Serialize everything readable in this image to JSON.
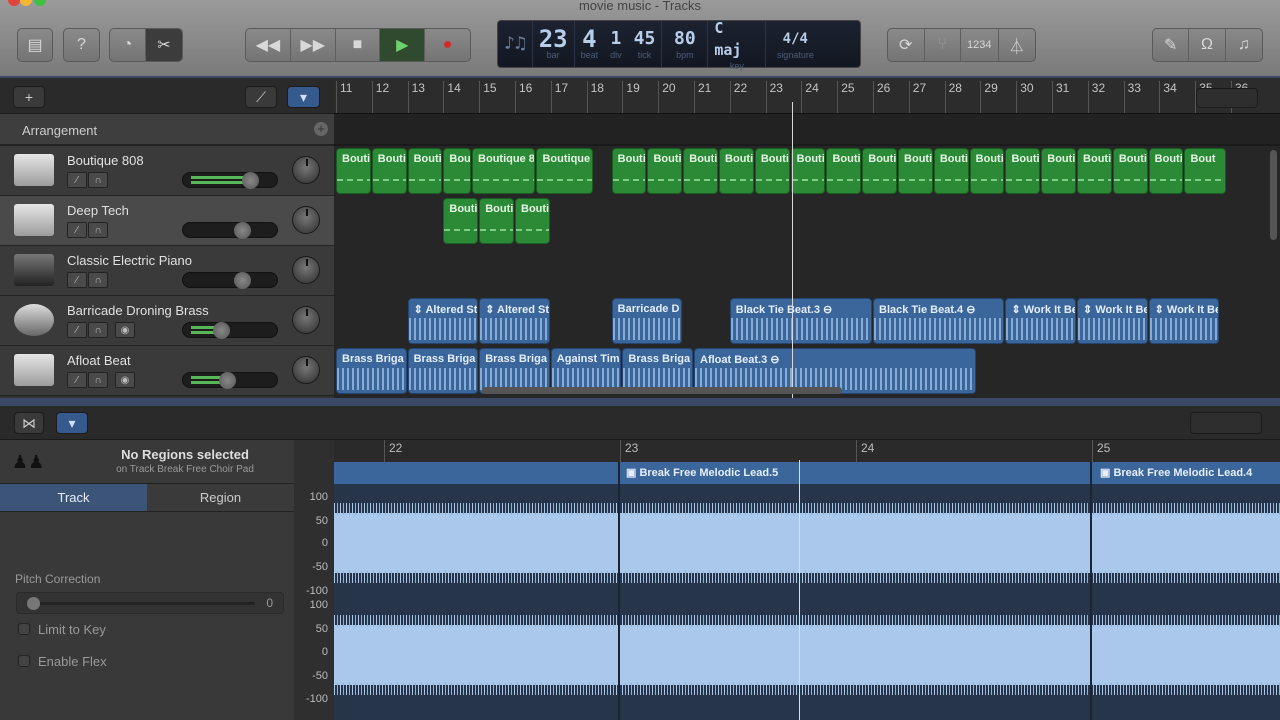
{
  "window": {
    "title": "movie music - Tracks"
  },
  "toolbar": {
    "left_buttons": [
      "library",
      "help",
      "smart-controls",
      "editors"
    ],
    "transport": [
      "rewind",
      "fast-forward",
      "stop",
      "play",
      "record"
    ],
    "right_buttons": [
      "cycle",
      "tuner",
      "count-in",
      "metronome"
    ],
    "far_right_buttons": [
      "note-pad",
      "loop-browser",
      "media-browser"
    ],
    "count_in_label": "1234"
  },
  "lcd": {
    "bar": "23",
    "bar_label": "bar",
    "beat": "4",
    "beat_label": "beat",
    "div": "1",
    "div_label": "div",
    "tick": "45",
    "tick_label": "tick",
    "bpm": "80",
    "bpm_label": "bpm",
    "key": "C maj",
    "key_label": "key",
    "signature": "4/4",
    "signature_label": "signature"
  },
  "tracks_header": {
    "arrangement_label": "Arrangement"
  },
  "tracks": [
    {
      "name": "Boutique 808",
      "volume": 0.82,
      "selected": false
    },
    {
      "name": "Deep Tech",
      "volume": 0.7,
      "selected": true
    },
    {
      "name": "Classic Electric Piano",
      "volume": 0.7,
      "selected": false
    },
    {
      "name": "Barricade Droning Brass",
      "volume": 0.35,
      "selected": false
    },
    {
      "name": "Afloat Beat",
      "volume": 0.45,
      "selected": false
    }
  ],
  "ruler": {
    "bars": [
      "11",
      "12",
      "13",
      "14",
      "15",
      "16",
      "17",
      "18",
      "19",
      "20",
      "21",
      "22",
      "23",
      "24",
      "25",
      "26",
      "27",
      "28",
      "29",
      "30",
      "31",
      "32",
      "33",
      "34",
      "35",
      "36"
    ]
  },
  "regions": {
    "lane0": [
      "Bouti",
      "Bouti",
      "Bouti",
      "Bou",
      "Boutique 80",
      "Boutique 8",
      "Bouti",
      "Bouti",
      "Bouti",
      "Bouti",
      "Bouti",
      "Bouti",
      "Bouti",
      "Bouti",
      "Bouti",
      "Bouti",
      "Bouti",
      "Bouti",
      "Bouti",
      "Bouti",
      "Bouti",
      "Bouti",
      "Bout"
    ],
    "lane1": [
      "Bouti",
      "Bouti",
      "Bouti"
    ],
    "lane3": [
      "⇕ Altered St",
      "⇕ Altered St",
      "Barricade D",
      "Black Tie Beat.3 ⊖",
      "Black Tie Beat.4 ⊖",
      "⇕ Work It Be",
      "⇕ Work It Be",
      "⇕ Work It Be"
    ],
    "lane4": [
      "Brass Briga",
      "Brass Briga",
      "Brass Briga",
      "Against Tim",
      "Brass Briga",
      "Afloat Beat.3 ⊖"
    ]
  },
  "editor": {
    "no_selection_title": "No Regions selected",
    "no_selection_sub": "on Track Break Free Choir Pad",
    "tabs": [
      "Track",
      "Region"
    ],
    "active_tab": "Track",
    "pitch_correction_label": "Pitch Correction",
    "pitch_correction_value": "0",
    "limit_to_key_label": "Limit to Key",
    "enable_flex_label": "Enable Flex",
    "scale_labels": [
      "100",
      "50",
      "0",
      "-50",
      "-100",
      "100",
      "50",
      "0",
      "-50",
      "-100"
    ],
    "bars": [
      "22",
      "23",
      "24",
      "25"
    ],
    "region_names": [
      "Break Free Melodic Lead.5",
      "Break Free Melodic Lead.4"
    ]
  }
}
